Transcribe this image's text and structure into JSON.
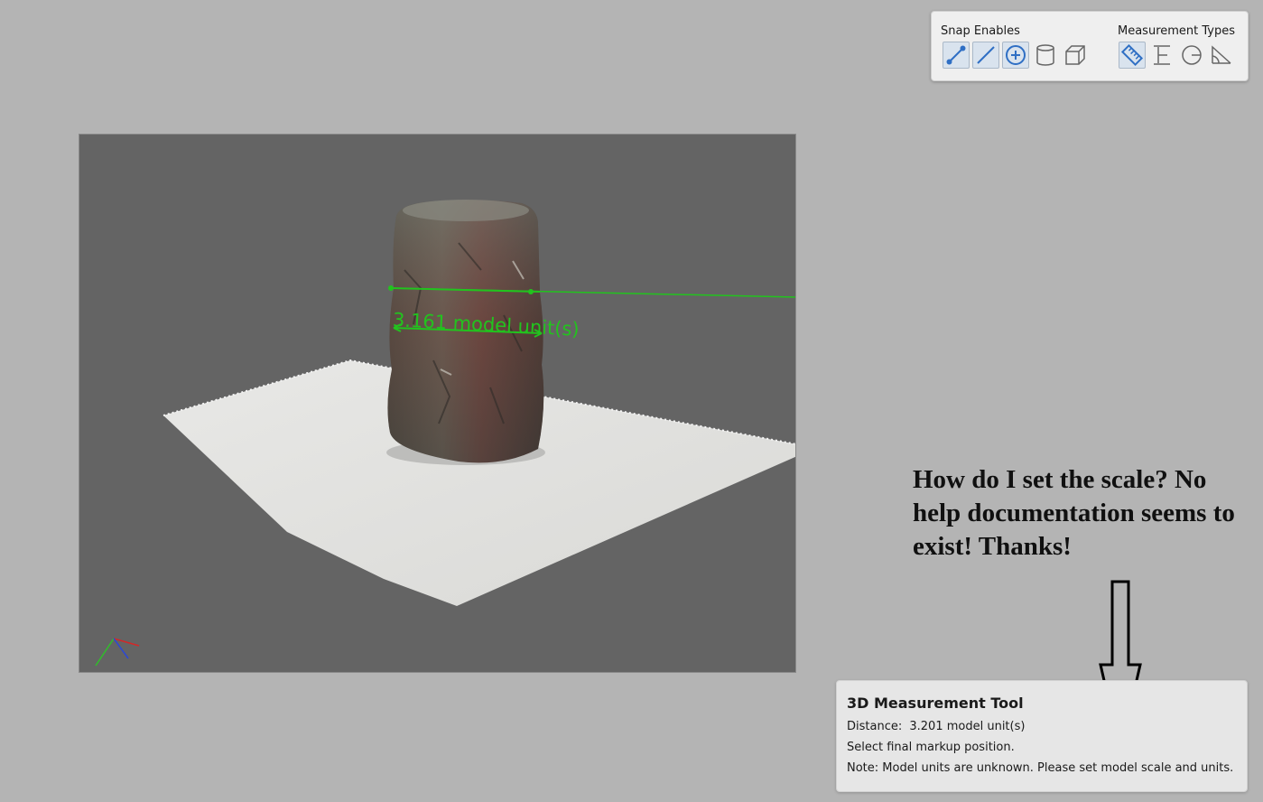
{
  "toolbar": {
    "snap_label": "Snap Enables",
    "measurement_label": "Measurement Types",
    "snap_buttons": [
      {
        "icon": "snap-vertex-icon",
        "active": true
      },
      {
        "icon": "snap-edge-icon",
        "active": true
      },
      {
        "icon": "snap-center-icon",
        "active": true
      },
      {
        "icon": "snap-cylinder-icon",
        "active": false
      },
      {
        "icon": "snap-box-icon",
        "active": false
      }
    ],
    "measurement_buttons": [
      {
        "icon": "ruler-distance-icon",
        "active": true
      },
      {
        "icon": "height-icon",
        "active": false
      },
      {
        "icon": "radius-icon",
        "active": false
      },
      {
        "icon": "angle-icon",
        "active": false
      }
    ]
  },
  "viewport": {
    "measurement_label": "3.161 model unit(s)",
    "colors": {
      "background": "#646464",
      "measure_line": "#22c31e"
    }
  },
  "annotation": {
    "question": "How do I set the scale? No help documentation seems to exist! Thanks!"
  },
  "info_panel": {
    "title": "3D Measurement Tool",
    "distance_label": "Distance:",
    "distance_value": "3.201 model unit(s)",
    "instruction": "Select final markup position.",
    "note": "Note: Model units are unknown.  Please set model scale and units."
  },
  "colors": {
    "accent": "#2f6fc4",
    "page_background": "#b4b4b4"
  }
}
